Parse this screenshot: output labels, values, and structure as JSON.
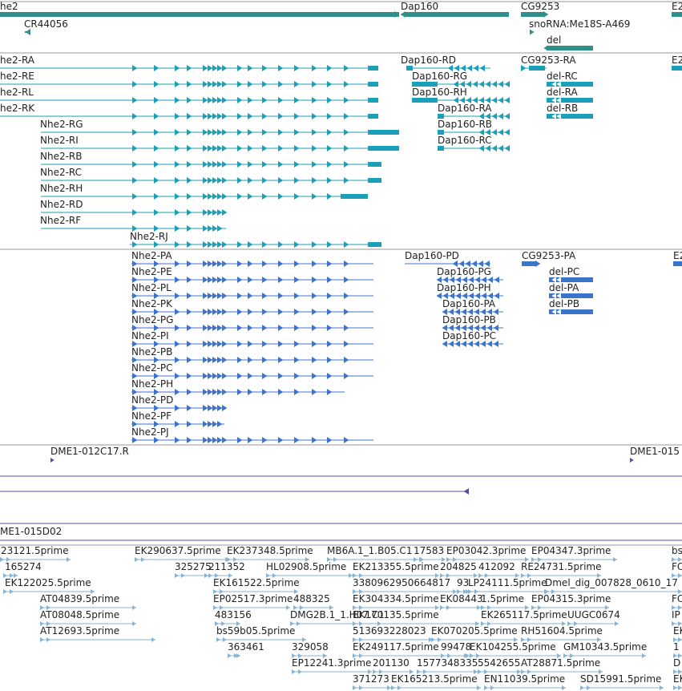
{
  "colors": {
    "gene": "#2e8f8b",
    "transcript": "#1aa1b9",
    "protein": "#3c74cc",
    "bac": "#5e4d96",
    "est": "#86b3d6",
    "divider": "#9a9a9a",
    "text": "#222222"
  },
  "gene_track": {
    "labels": [
      "he2",
      "Dap160",
      "CG9253",
      "E2",
      "CR44056",
      "snoRNA:Me18S-A469",
      "del"
    ]
  },
  "transcript_track": {
    "labels": [
      "he2-RA",
      "he2-RE",
      "he2-RL",
      "he2-RK",
      "Nhe2-RG",
      "Nhe2-RI",
      "Nhe2-RB",
      "Nhe2-RC",
      "Nhe2-RH",
      "Nhe2-RD",
      "Nhe2-RF",
      "Nhe2-RJ",
      "Dap160-RD",
      "Dap160-RG",
      "Dap160-RH",
      "Dap160-RA",
      "Dap160-RB",
      "Dap160-RC",
      "CG9253-RA",
      "E2",
      "del-RC",
      "del-RA",
      "del-RB"
    ]
  },
  "protein_track": {
    "labels": [
      "Nhe2-PA",
      "Nhe2-PE",
      "Nhe2-PL",
      "Nhe2-PK",
      "Nhe2-PG",
      "Nhe2-PI",
      "Nhe2-PB",
      "Nhe2-PC",
      "Nhe2-PH",
      "Nhe2-PD",
      "Nhe2-PF",
      "Nhe2-PJ",
      "Dap160-PD",
      "Dap160-PG",
      "Dap160-PH",
      "Dap160-PA",
      "Dap160-PB",
      "Dap160-PC",
      "CG9253-PA",
      "E2",
      "del-PC",
      "del-PA",
      "del-PB"
    ]
  },
  "bac_track": {
    "labels": [
      "DME1-012C17.R",
      "DME1-015",
      "ME1-015D02"
    ]
  },
  "est_track": {
    "labels": [
      "23121.5prime",
      "165274",
      "EK122025.5prime",
      "AT04839.5prime",
      "AT08048.5prime",
      "AT12693.5prime",
      "EK290637.5prime",
      "EK237348.5prime",
      "325275",
      "211352",
      "EK161522.5prime",
      "EP02517.3prime",
      "488325",
      "483156",
      "bs59b05.5prime",
      "363461",
      "HL02908.5prime",
      "MB6A.1_1.B05.C1",
      "17583",
      "EP03042.3prime",
      "EP04347.3prime",
      "EK213355.5prime",
      "204825",
      "412092",
      "RE24731.5prime",
      "3380962950664817",
      "93",
      "LP24111.5prime",
      "Dmel_dig_007828_0610_17",
      "EK304334.5prime",
      "EK08443",
      "1.5prime",
      "EP04315.3prime",
      "DMG2B.1_1.H07.C1",
      "EK170135.5prime",
      "EK265117.5prime",
      "UUGC0674",
      "513693228023",
      "EK070205.5prime",
      "RH51604.5prime",
      "329058",
      "EK249117.5prime",
      "99478",
      "EK104255.5prime",
      "GM10343.5prime",
      "EP12241.3prime",
      "201130",
      "1577348335",
      "5542655",
      "AT28871.5prime",
      "371273",
      "EK165213.5prime",
      "EN11039.5prime",
      "SD15991.5prime",
      "bs",
      "FC",
      "FC",
      "IP",
      "EK",
      "1",
      "D",
      "EK"
    ]
  }
}
